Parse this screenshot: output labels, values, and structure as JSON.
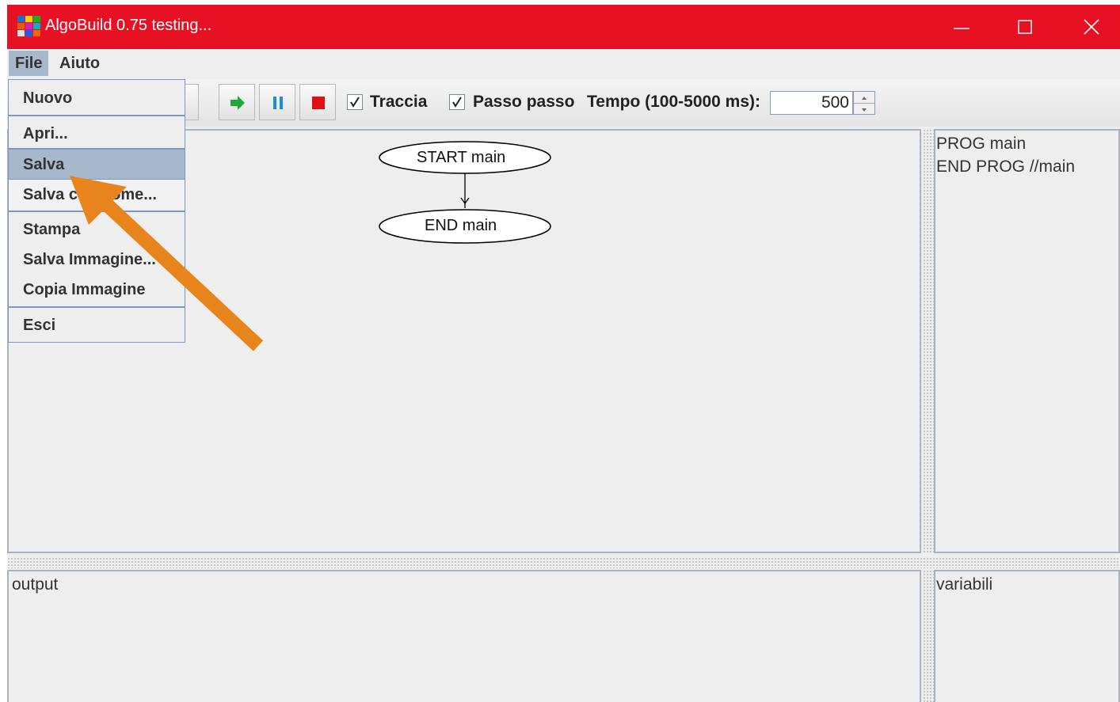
{
  "window": {
    "title": "AlgoBuild 0.75 testing..."
  },
  "menubar": {
    "file": "File",
    "help": "Aiuto"
  },
  "file_menu": {
    "items": [
      "Nuovo",
      "Apri...",
      "Salva",
      "Salva con nome...",
      "Stampa",
      "Salva Immagine...",
      "Copia Immagine",
      "Esci"
    ],
    "selected": "Salva"
  },
  "toolbar": {
    "trace_label": "Traccia",
    "trace_checked": true,
    "step_label": "Passo passo",
    "step_checked": true,
    "time_label": "Tempo (100-5000 ms):",
    "time_value": "500"
  },
  "flowchart": {
    "start_label": "START main",
    "end_label": "END main"
  },
  "code": {
    "lines": [
      "PROG main",
      "END PROG //main"
    ]
  },
  "output": {
    "label": "output"
  },
  "variables": {
    "label": "variabili"
  },
  "colors": {
    "titlebar": "#e81123",
    "menu_highlight": "#a8b8cc",
    "annotation_arrow": "#e8841c"
  }
}
